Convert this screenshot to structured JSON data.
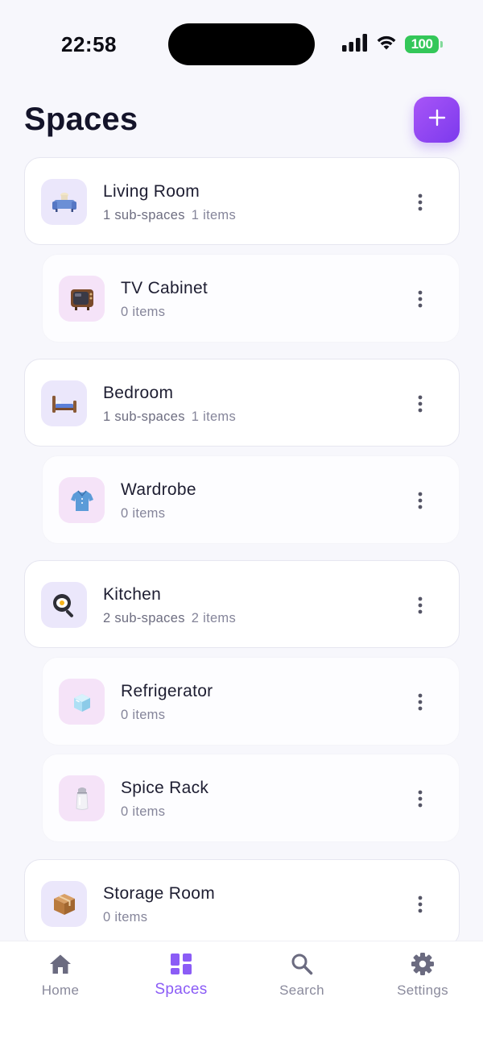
{
  "status_bar": {
    "time": "22:58",
    "battery": "100",
    "icons": [
      "signal-icon",
      "wifi-icon",
      "battery-icon"
    ]
  },
  "header": {
    "title": "Spaces",
    "add_icon": "plus-icon"
  },
  "colors": {
    "accent": "#8b5cf6",
    "accent_gradient_start": "#a855f7",
    "accent_gradient_end": "#7c3aed",
    "battery": "#34c759"
  },
  "spaces": [
    {
      "name": "Living Room",
      "sub_spaces": "1 sub-spaces",
      "items": "1 items",
      "icon": "sofa-icon",
      "level": "parent"
    },
    {
      "name": "TV Cabinet",
      "sub_spaces": "",
      "items": "0 items",
      "icon": "television-icon",
      "level": "child"
    },
    {
      "name": "Bedroom",
      "sub_spaces": "1 sub-spaces",
      "items": "1 items",
      "icon": "bed-icon",
      "level": "parent"
    },
    {
      "name": "Wardrobe",
      "sub_spaces": "",
      "items": "0 items",
      "icon": "shirt-icon",
      "level": "child"
    },
    {
      "name": "Kitchen",
      "sub_spaces": "2 sub-spaces",
      "items": "2 items",
      "icon": "frying-pan-icon",
      "level": "parent"
    },
    {
      "name": "Refrigerator",
      "sub_spaces": "",
      "items": "0 items",
      "icon": "ice-cube-icon",
      "level": "child"
    },
    {
      "name": "Spice Rack",
      "sub_spaces": "",
      "items": "0 items",
      "icon": "salt-shaker-icon",
      "level": "child"
    },
    {
      "name": "Storage Room",
      "sub_spaces": "",
      "items": "0 items",
      "icon": "package-icon",
      "level": "parent"
    }
  ],
  "tab_bar": {
    "tabs": [
      {
        "label": "Home",
        "icon": "home-icon",
        "active": false
      },
      {
        "label": "Spaces",
        "icon": "grid-icon",
        "active": true
      },
      {
        "label": "Search",
        "icon": "search-icon",
        "active": false
      },
      {
        "label": "Settings",
        "icon": "gear-icon",
        "active": false
      }
    ]
  }
}
